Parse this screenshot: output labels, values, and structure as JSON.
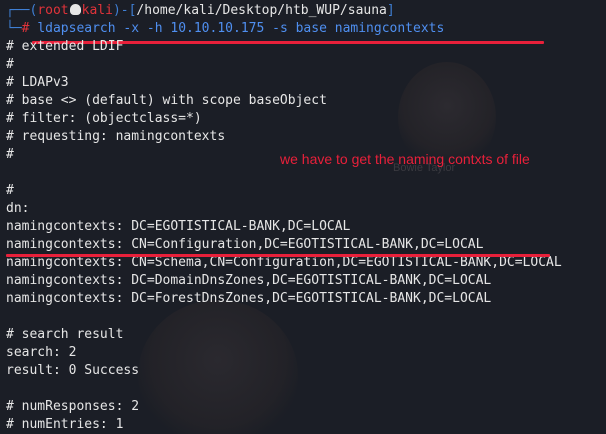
{
  "prompt": {
    "corner_top": "┌──",
    "open_paren": "(",
    "user": "root",
    "skull_icon": "skull-icon",
    "host": "kali",
    "close_paren": ")",
    "dash": "-[",
    "path": "/home/kali/Desktop/htb_WUP/sauna",
    "close_bracket": "]",
    "corner_bottom": "└─",
    "hash": "# "
  },
  "command": {
    "name": "ldapsearch",
    "args": " -x -h 10.10.10.175 -s base namingcontexts"
  },
  "output_lines": [
    "# extended LDIF",
    "#",
    "# LDAPv3",
    "# base <> (default) with scope baseObject",
    "# filter: (objectclass=*)",
    "# requesting: namingcontexts",
    "#",
    "",
    "#",
    "dn:",
    "namingcontexts: DC=EGOTISTICAL-BANK,DC=LOCAL",
    "namingcontexts: CN=Configuration,DC=EGOTISTICAL-BANK,DC=LOCAL",
    "namingcontexts: CN=Schema,CN=Configuration,DC=EGOTISTICAL-BANK,DC=LOCAL",
    "namingcontexts: DC=DomainDnsZones,DC=EGOTISTICAL-BANK,DC=LOCAL",
    "namingcontexts: DC=ForestDnsZones,DC=EGOTISTICAL-BANK,DC=LOCAL",
    "",
    "# search result",
    "search: 2",
    "result: 0 Success",
    "",
    "# numResponses: 2",
    "# numEntries: 1"
  ],
  "annotation": "we have to get the naming contxts of file",
  "background_caption": "Bowie Taylor",
  "colors": {
    "background": "#1b1e26",
    "prompt_blue": "#3f7fd4",
    "prompt_red": "#e0333a",
    "command": "#4f8ff0",
    "text": "#e6e6e6",
    "annotation": "#e8203a"
  }
}
